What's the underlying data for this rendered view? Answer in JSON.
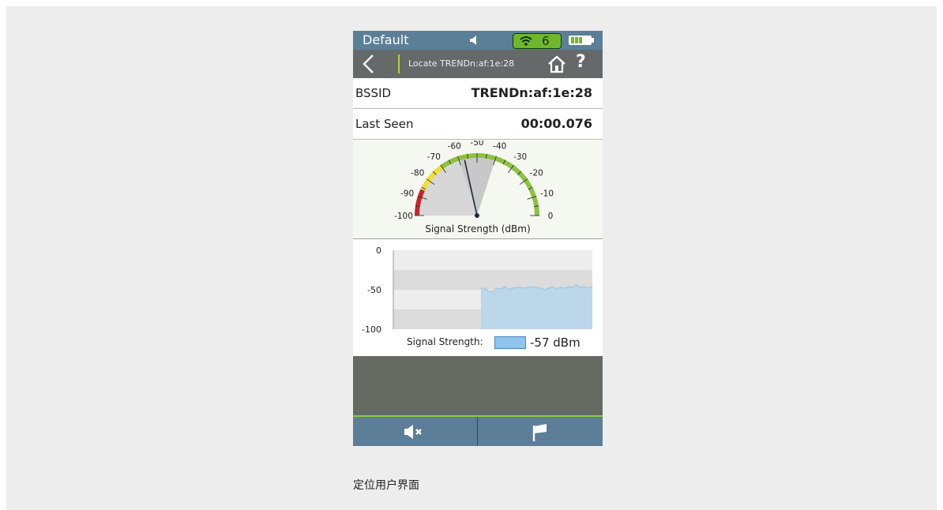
{
  "status_bar": {
    "profile": "Default",
    "wifi_count": "6",
    "speaker_icon": "speaker-icon",
    "wifi_icon": "wifi-icon",
    "battery_icon": "battery-icon"
  },
  "nav_bar": {
    "title": "Locate TRENDn:af:1e:28",
    "back_icon": "chevron-left-icon",
    "home_icon": "home-icon",
    "help_label": "?"
  },
  "rows": [
    {
      "label": "BSSID",
      "value": "TRENDn:af:1e:28"
    },
    {
      "label": "Last Seen",
      "value": "00:00.076"
    }
  ],
  "gauge": {
    "caption": "Signal Strength (dBm)",
    "ticks": [
      "-100",
      "-90",
      "-80",
      "-70",
      "-60",
      "-50",
      "-40",
      "-30",
      "-20",
      "-10",
      "0"
    ],
    "min": -100,
    "max": 0,
    "needle_value": -57,
    "range_start": -60,
    "range_end": -40,
    "colors": {
      "red": "#c8242b",
      "yellow": "#f0e02c",
      "green": "#8dc13f",
      "range": "#c8c8c8",
      "needle": "#1a2a40"
    }
  },
  "chart_data": {
    "type": "area",
    "ylim": [
      -100,
      0
    ],
    "yticks": [
      "0",
      "-50",
      "-100"
    ],
    "x": [
      0,
      1,
      2,
      3,
      4,
      5,
      6,
      7,
      8,
      9,
      10,
      11,
      12,
      13,
      14,
      15,
      16,
      17,
      18,
      19,
      20,
      21,
      22,
      23,
      24,
      25,
      26,
      27,
      28,
      29,
      30,
      31,
      32,
      33,
      34,
      35,
      36,
      37,
      38,
      39,
      40,
      41,
      42,
      43,
      44,
      45,
      46,
      47,
      48,
      49,
      50
    ],
    "series": [
      {
        "values": [
          null,
          null,
          null,
          null,
          null,
          null,
          null,
          null,
          null,
          null,
          null,
          null,
          null,
          null,
          null,
          null,
          null,
          null,
          null,
          null,
          null,
          null,
          -48,
          -48,
          -52,
          -52,
          -48,
          -49,
          -46,
          -50,
          -48,
          -47,
          -47,
          -48,
          -47,
          -46,
          -47,
          -48,
          -50,
          -48,
          -46,
          -49,
          -47,
          -48,
          -46,
          -47,
          -44,
          -47,
          -46,
          -48,
          -45
        ]
      }
    ],
    "legend_label": "Signal Strength:",
    "legend_value": "-57 dBm",
    "color": "#bcd6ea"
  },
  "bottom_bar": {
    "mute_icon": "speaker-mute-icon",
    "flag_icon": "flag-icon"
  },
  "caption": "定位用户界面"
}
